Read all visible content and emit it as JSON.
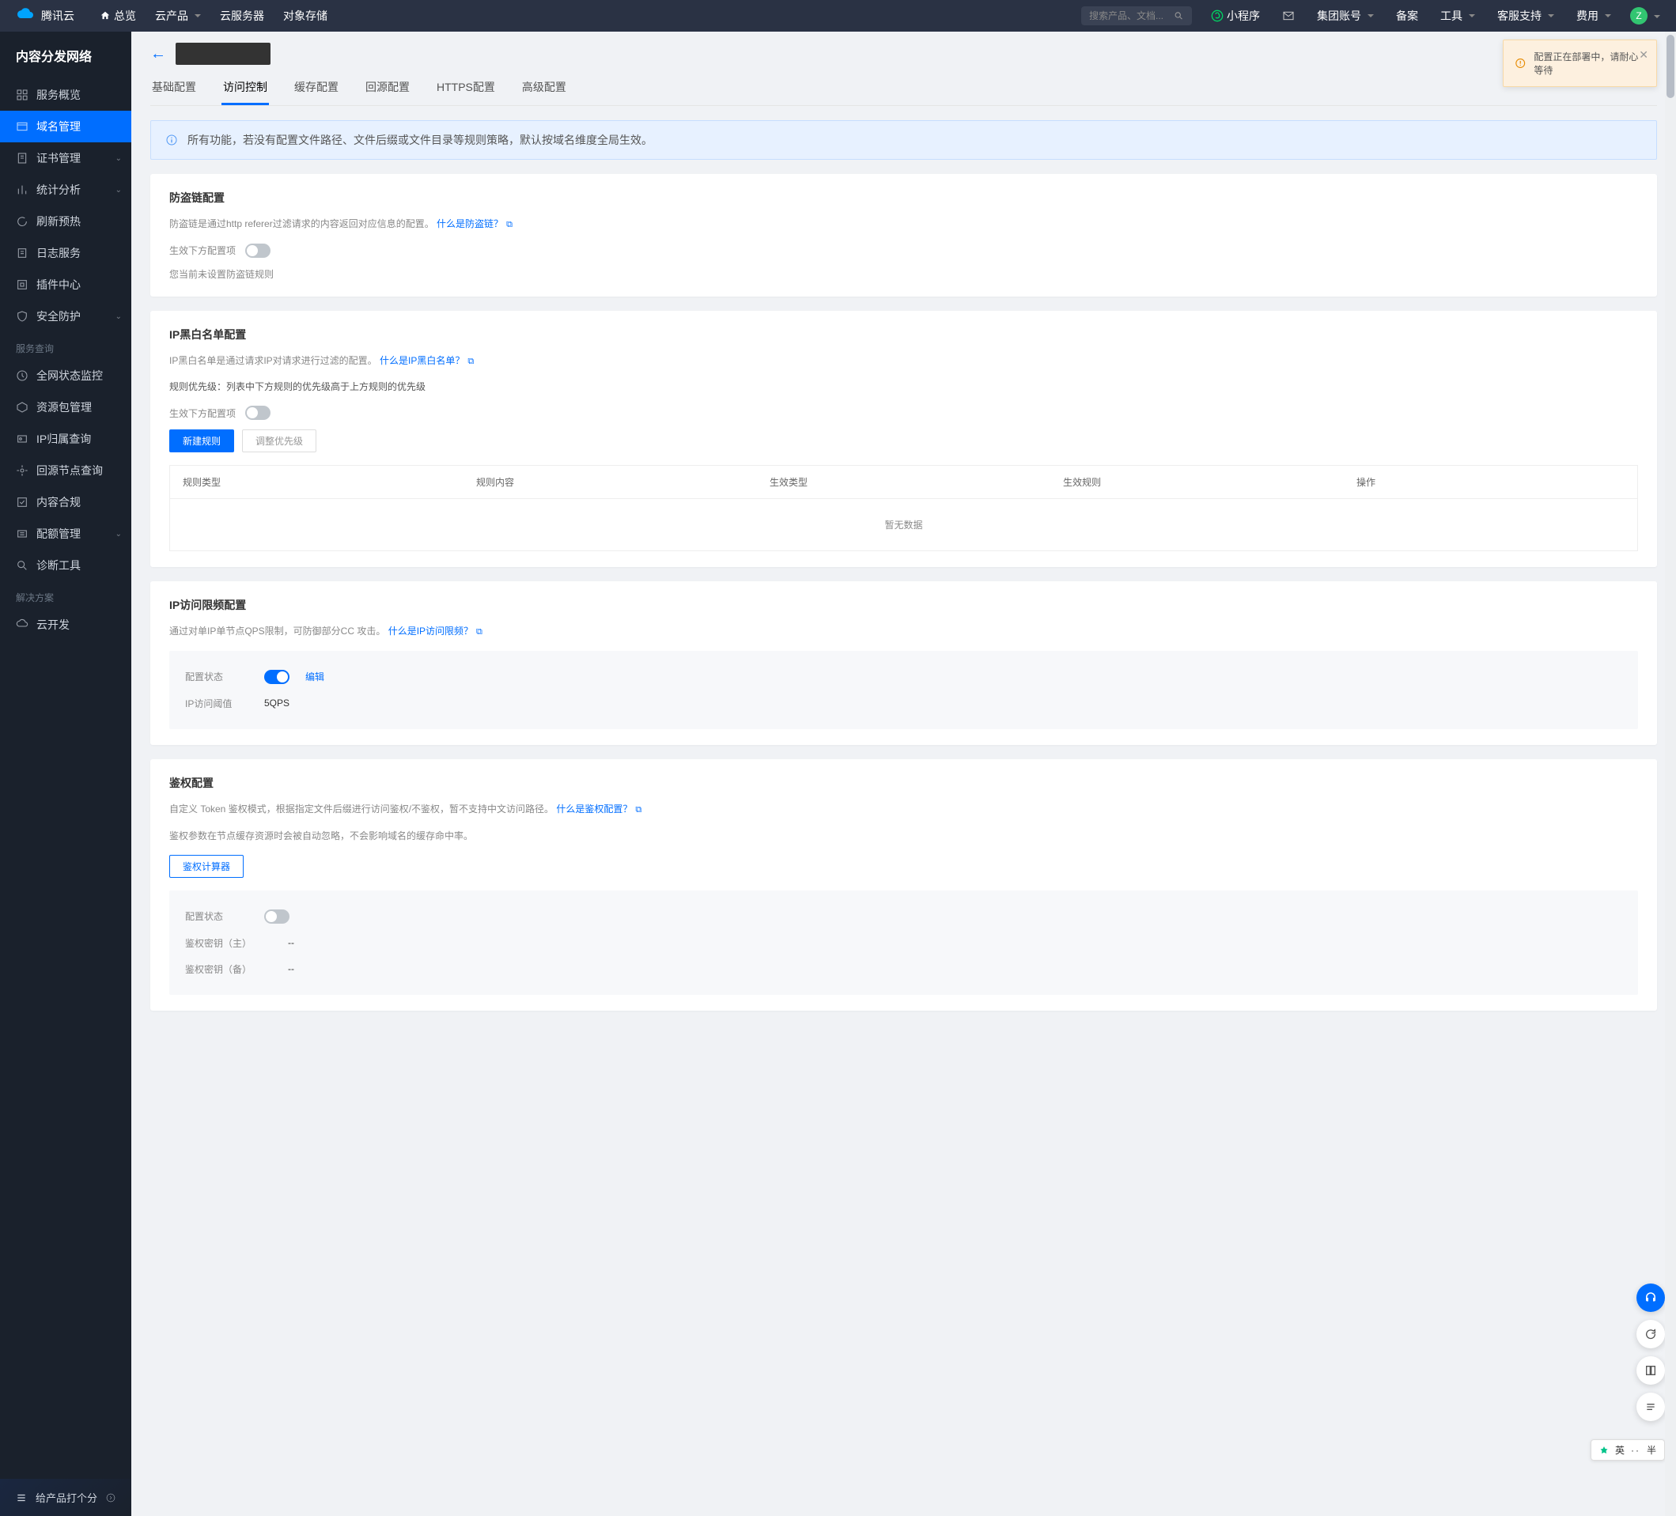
{
  "topbar": {
    "brand": "腾讯云",
    "overview": "总览",
    "products": "云产品",
    "cvm": "云服务器",
    "cos": "对象存储",
    "search_placeholder": "搜索产品、文档...",
    "miniprogram": "小程序",
    "group_account": "集团账号",
    "beian": "备案",
    "tools": "工具",
    "support": "客服支持",
    "fee": "费用",
    "avatar_letter": "Z"
  },
  "sidebar": {
    "title": "内容分发网络",
    "items": [
      {
        "icon": "overview",
        "label": "服务概览"
      },
      {
        "icon": "domain",
        "label": "域名管理",
        "active": true
      },
      {
        "icon": "cert",
        "label": "证书管理",
        "expandable": true
      },
      {
        "icon": "stats",
        "label": "统计分析",
        "expandable": true
      },
      {
        "icon": "refresh",
        "label": "刷新预热"
      },
      {
        "icon": "log",
        "label": "日志服务"
      },
      {
        "icon": "plugin",
        "label": "插件中心"
      },
      {
        "icon": "shield",
        "label": "安全防护",
        "expandable": true
      }
    ],
    "section1_title": "服务查询",
    "section1": [
      {
        "icon": "monitor",
        "label": "全网状态监控"
      },
      {
        "icon": "package",
        "label": "资源包管理"
      },
      {
        "icon": "ipquery",
        "label": "IP归属查询"
      },
      {
        "icon": "origin",
        "label": "回源节点查询"
      },
      {
        "icon": "compliance",
        "label": "内容合规"
      },
      {
        "icon": "quota",
        "label": "配额管理",
        "expandable": true
      },
      {
        "icon": "diag",
        "label": "诊断工具"
      }
    ],
    "section2_title": "解决方案",
    "section2": [
      {
        "icon": "cloud",
        "label": "云开发"
      }
    ],
    "footer_text": "给产品打个分"
  },
  "notice": {
    "text": "配置正在部署中，请耐心等待"
  },
  "tabs": [
    "基础配置",
    "访问控制",
    "缓存配置",
    "回源配置",
    "HTTPS配置",
    "高级配置"
  ],
  "active_tab": 1,
  "infobar": "所有功能，若没有配置文件路径、文件后缀或文件目录等规则策略，默认按域名维度全局生效。",
  "hotlink": {
    "title": "防盗链配置",
    "desc": "防盗链是通过http referer过滤请求的内容返回对应信息的配置。",
    "link": "什么是防盗链？",
    "toggle_label": "生效下方配置项",
    "empty": "您当前未设置防盗链规则"
  },
  "ipbw": {
    "title": "IP黑白名单配置",
    "desc": "IP黑白名单是通过请求IP对请求进行过滤的配置。",
    "link": "什么是IP黑白名单？",
    "priority_note": "规则优先级：列表中下方规则的优先级高于上方规则的优先级",
    "toggle_label": "生效下方配置项",
    "btn_new": "新建规则",
    "btn_adjust": "调整优先级",
    "cols": [
      "规则类型",
      "规则内容",
      "生效类型",
      "生效规则",
      "操作"
    ],
    "empty": "暂无数据"
  },
  "iprate": {
    "title": "IP访问限频配置",
    "desc": "通过对单IP单节点QPS限制，可防御部分CC 攻击。",
    "link": "什么是IP访问限频？",
    "status_label": "配置状态",
    "edit": "编辑",
    "threshold_label": "IP访问阈值",
    "threshold_value": "5QPS"
  },
  "auth": {
    "title": "鉴权配置",
    "desc1": "自定义 Token 鉴权模式，根据指定文件后缀进行访问鉴权/不鉴权，暂不支持中文访问路径。",
    "link": "什么是鉴权配置？",
    "desc2": "鉴权参数在节点缓存资源时会被自动忽略，不会影响域名的缓存命中率。",
    "calc_btn": "鉴权计算器",
    "status_label": "配置状态",
    "key_main_label": "鉴权密钥（主）",
    "key_main_value": "--",
    "key_backup_label": "鉴权密钥（备）",
    "key_backup_value": "--"
  },
  "ime": {
    "lang": "英",
    "dot": "··",
    "half": "半"
  }
}
